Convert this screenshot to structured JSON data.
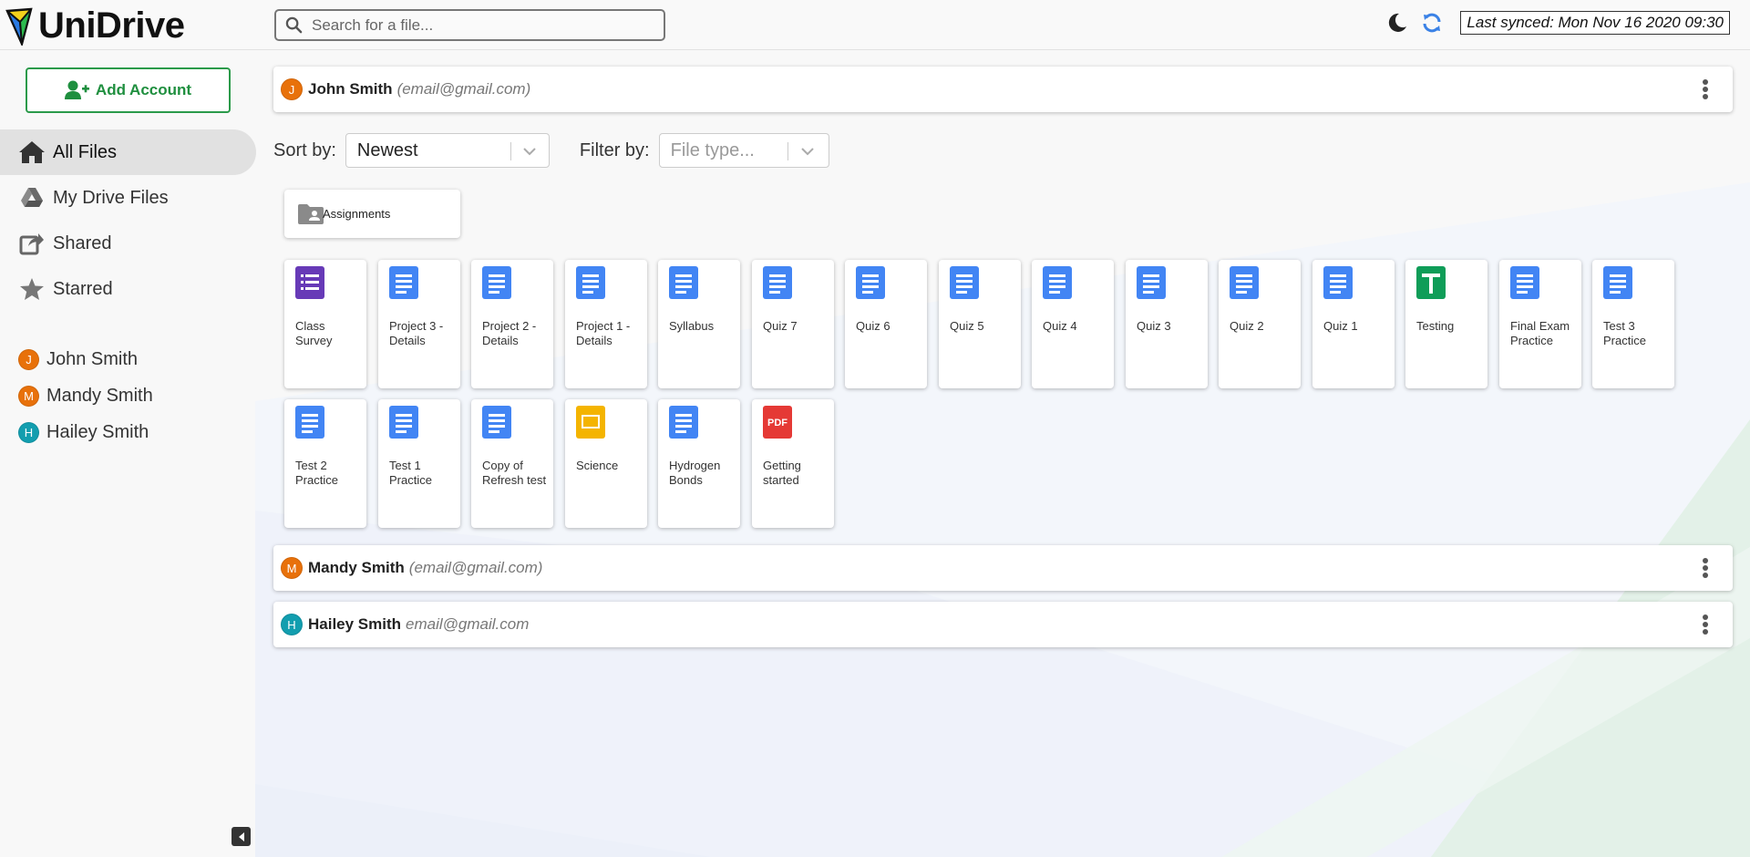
{
  "app": {
    "title": "UniDrive"
  },
  "header": {
    "search_placeholder": "Search for a file...",
    "sync_status": "Last synced: Mon Nov 16 2020 09:30",
    "icons": [
      "moon-icon",
      "refresh-icon"
    ]
  },
  "sidebar": {
    "add_account_label": "Add Account",
    "nav": [
      {
        "label": "All Files",
        "icon": "home-icon",
        "active": true
      },
      {
        "label": "My Drive Files",
        "icon": "google-drive-icon"
      },
      {
        "label": "Shared",
        "icon": "share-icon"
      },
      {
        "label": "Starred",
        "icon": "star-icon"
      }
    ],
    "accounts": [
      {
        "initial": "J",
        "name": "John Smith",
        "color": "#e8710a"
      },
      {
        "initial": "M",
        "name": "Mandy Smith",
        "color": "#e8710a"
      },
      {
        "initial": "H",
        "name": "Hailey Smith",
        "color": "#129eaf"
      }
    ]
  },
  "main": {
    "account_sections": [
      {
        "initial": "J",
        "name": "John Smith",
        "email": "(email@gmail.com)",
        "color": "#e8710a",
        "expanded": true
      },
      {
        "initial": "M",
        "name": "Mandy Smith",
        "email": "(email@gmail.com)",
        "color": "#e8710a",
        "expanded": false
      },
      {
        "initial": "H",
        "name": "Hailey Smith",
        "email": "email@gmail.com",
        "color": "#129eaf",
        "expanded": false
      }
    ],
    "sort_label": "Sort by:",
    "sort_value": "Newest",
    "filter_label": "Filter by:",
    "filter_placeholder": "File type...",
    "folders": [
      {
        "name": "Assignments",
        "icon": "shared-folder-icon"
      }
    ],
    "files": [
      {
        "name": "Class Survey",
        "type": "form"
      },
      {
        "name": "Project 3 - Details",
        "type": "doc"
      },
      {
        "name": "Project 2 - Details",
        "type": "doc"
      },
      {
        "name": "Project 1 - Details",
        "type": "doc"
      },
      {
        "name": "Syllabus",
        "type": "doc"
      },
      {
        "name": "Quiz 7",
        "type": "doc"
      },
      {
        "name": "Quiz 6",
        "type": "doc"
      },
      {
        "name": "Quiz 5",
        "type": "doc"
      },
      {
        "name": "Quiz 4",
        "type": "doc"
      },
      {
        "name": "Quiz 3",
        "type": "doc"
      },
      {
        "name": "Quiz 2",
        "type": "doc"
      },
      {
        "name": "Quiz 1",
        "type": "doc"
      },
      {
        "name": "Testing",
        "type": "sheet"
      },
      {
        "name": "Final Exam Practice",
        "type": "doc"
      },
      {
        "name": "Test 3 Practice",
        "type": "doc"
      },
      {
        "name": "Test 2 Practice",
        "type": "doc"
      },
      {
        "name": "Test 1 Practice",
        "type": "doc"
      },
      {
        "name": "Copy of Refresh test",
        "type": "doc"
      },
      {
        "name": "Science",
        "type": "slides"
      },
      {
        "name": "Hydrogen Bonds",
        "type": "doc"
      },
      {
        "name": "Getting started",
        "type": "pdf"
      }
    ]
  },
  "colors": {
    "accent_green": "#2b9a4a",
    "doc_blue": "#4285f4",
    "form_purple": "#673ab7",
    "sheet_green": "#0f9d58",
    "slides_yellow": "#f4b400",
    "pdf_red": "#e53935"
  }
}
